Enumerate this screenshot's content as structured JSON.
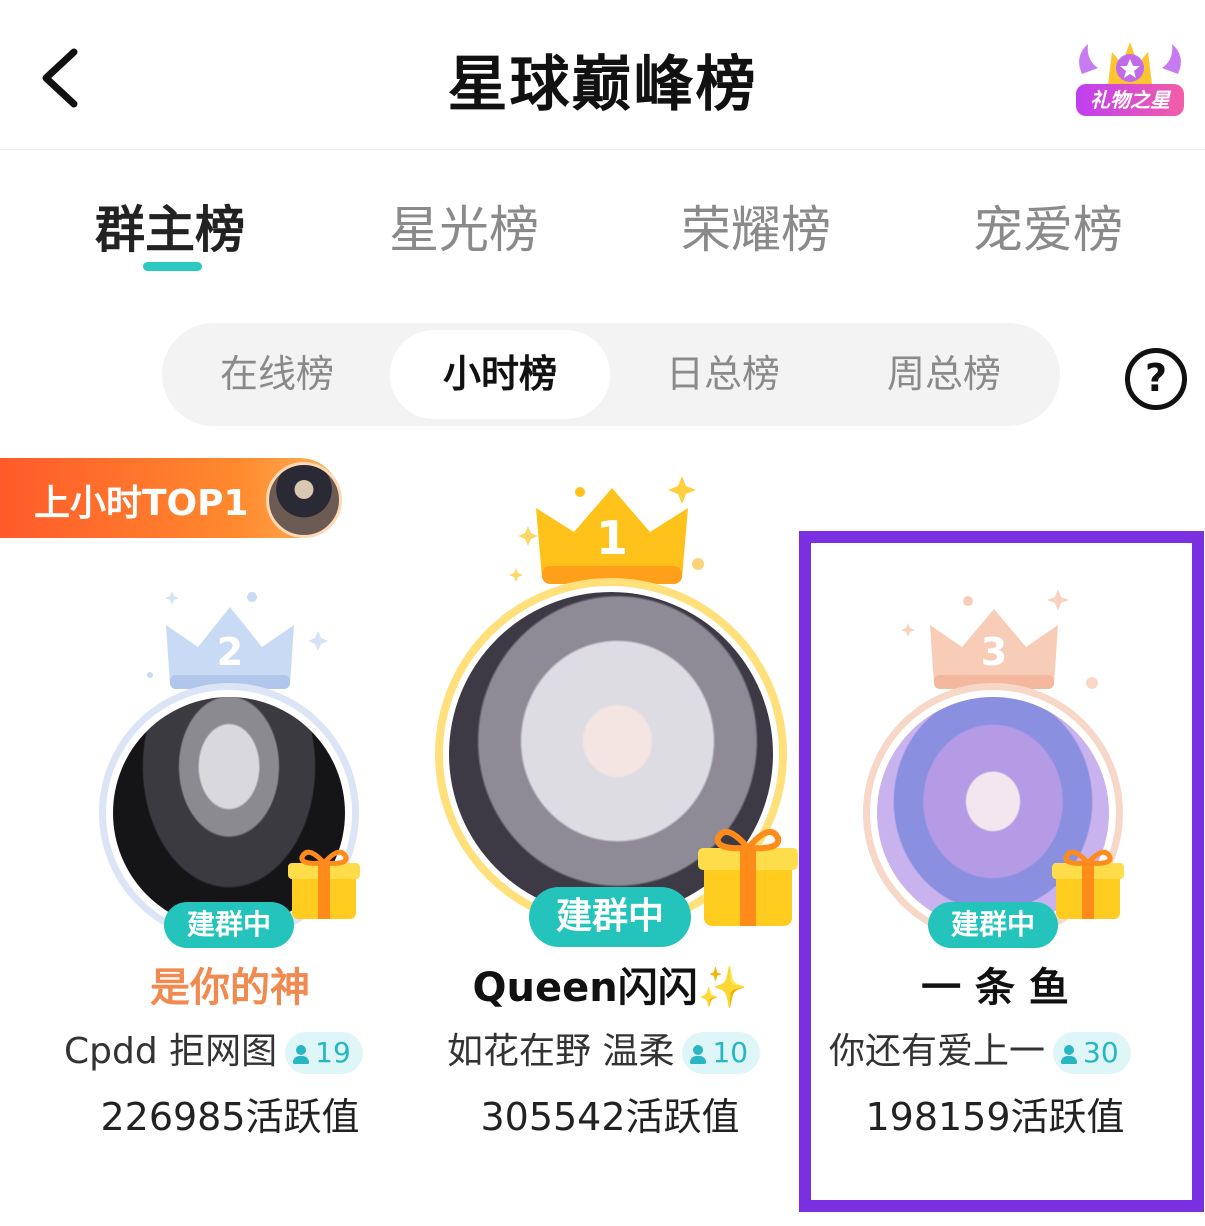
{
  "header": {
    "title": "星球巅峰榜",
    "back_icon": "chevron-left-icon",
    "badge_label": "礼物之星"
  },
  "main_tabs": [
    {
      "label": "群主榜",
      "active": true
    },
    {
      "label": "星光榜",
      "active": false
    },
    {
      "label": "荣耀榜",
      "active": false
    },
    {
      "label": "宠爱榜",
      "active": false
    }
  ],
  "sub_tabs": [
    {
      "label": "在线榜",
      "active": false
    },
    {
      "label": "小时榜",
      "active": true
    },
    {
      "label": "日总榜",
      "active": false
    },
    {
      "label": "周总榜",
      "active": false
    }
  ],
  "help_icon": "question-circle-icon",
  "top1_banner": {
    "label": "上小时TOP1"
  },
  "podium": [
    {
      "rank": "2",
      "status": "建群中",
      "nickname": "是你的神",
      "group_name": "Cpdd 拒网图",
      "member_count": "19",
      "activity": "226985活跃值",
      "nickname_color": "#f08a50",
      "crown_color": "#b9cdef"
    },
    {
      "rank": "1",
      "status": "建群中",
      "nickname": "Queen闪闪✨",
      "group_name": "如花在野 温柔",
      "member_count": "10",
      "activity": "305542活跃值",
      "nickname_color": "#111111",
      "crown_color": "#ffc21a"
    },
    {
      "rank": "3",
      "status": "建群中",
      "nickname": "一 条 鱼",
      "group_name": "你还有爱上一",
      "member_count": "30",
      "activity": "198159活跃值",
      "nickname_color": "#111111",
      "crown_color": "#f5c3ac"
    }
  ],
  "colors": {
    "accent": "#2cc9c3",
    "highlight": "#7a2fe0",
    "banner": "#ff7a2e"
  }
}
